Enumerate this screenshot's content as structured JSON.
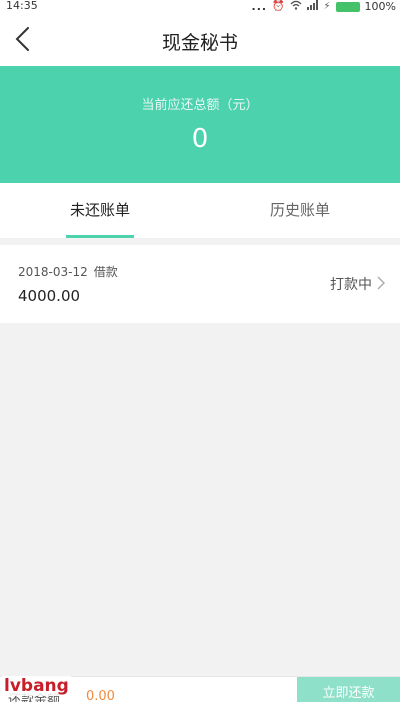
{
  "status_bar": {
    "time": "14:35",
    "dots": "...",
    "battery_percent": "100%",
    "icons": [
      "alarm-icon",
      "wifi-icon",
      "signal-icon",
      "charging-icon"
    ],
    "battery_color": "#43c26a"
  },
  "nav": {
    "title": "现金秘书",
    "back_icon": "chevron-left-icon"
  },
  "hero": {
    "label": "当前应还总额（元）",
    "amount": "0",
    "color": "#4dd2ae"
  },
  "tabs": [
    {
      "label": "未还账单",
      "active": true
    },
    {
      "label": "历史账单",
      "active": false
    }
  ],
  "loan": {
    "date": "2018-03-12",
    "type": "借款",
    "amount": "4000.00",
    "status": "打款中"
  },
  "bottom_bar": {
    "label": "还款金额",
    "value": "0.00",
    "pay_button": "立即还款"
  },
  "watermark": "lvbang"
}
